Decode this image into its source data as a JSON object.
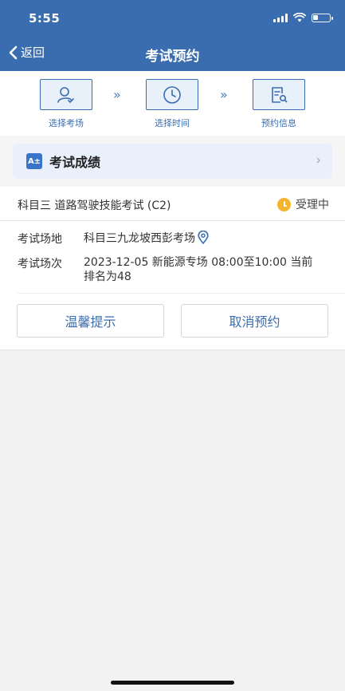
{
  "status_bar": {
    "time": "5:55"
  },
  "nav": {
    "back_label": "返回",
    "title": "考试预约"
  },
  "steps": [
    {
      "label": "选择考场",
      "icon": "person-check-icon"
    },
    {
      "label": "选择时间",
      "icon": "clock-icon"
    },
    {
      "label": "预约信息",
      "icon": "document-search-icon"
    }
  ],
  "score": {
    "label": "考试成绩",
    "icon_text": "A±"
  },
  "appointment": {
    "title": "科目三 道路驾驶技能考试 (C2)",
    "status": "受理中",
    "venue_label": "考试场地",
    "venue_value": "科目三九龙坡西彭考场",
    "session_label": "考试场次",
    "session_line1": "2023-12-05 新能源专场 08:00至10:00 当前",
    "session_line2": "排名为48"
  },
  "actions": {
    "tips_label": "温馨提示",
    "cancel_label": "取消预约"
  },
  "colors": {
    "primary": "#3a6db0",
    "status_dot": "#f4b52d",
    "banner_bg": "#e9f0fb"
  }
}
